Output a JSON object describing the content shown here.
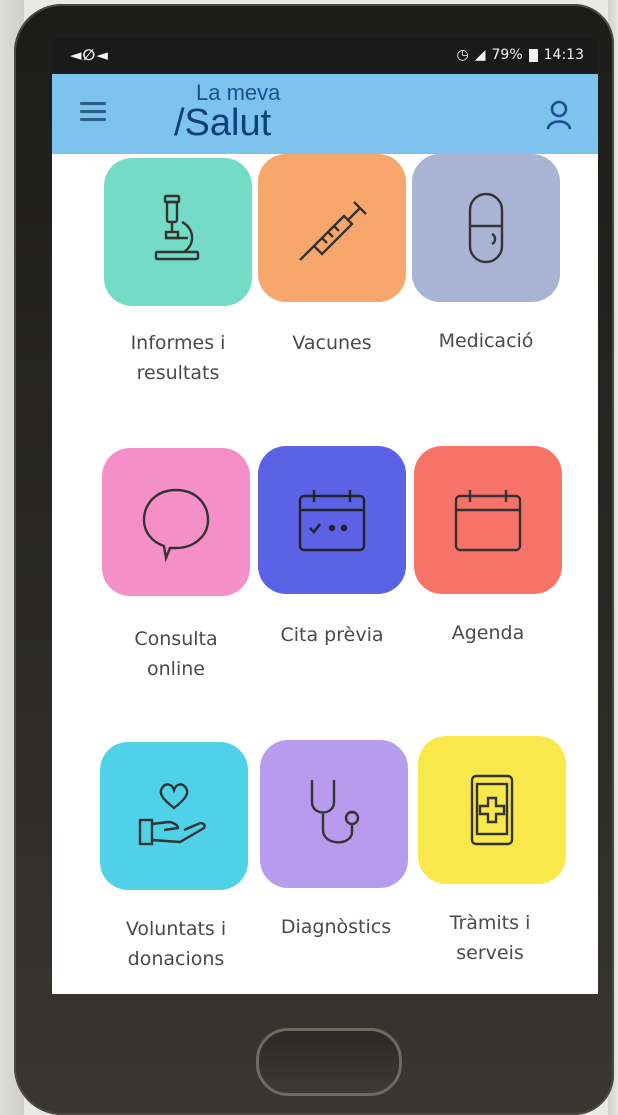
{
  "status_bar": {
    "left_icons": "◄∅◄",
    "battery": "79%",
    "time": "14:13"
  },
  "header": {
    "logo_line1": "La meva",
    "logo_line2": "/Salut",
    "menu_icon": "hamburger-icon",
    "profile_icon": "user-icon"
  },
  "tiles": [
    {
      "id": "informes",
      "label_lines": [
        "Informes i",
        "resultats"
      ],
      "color": "#74dbc6",
      "icon": "microscope-icon"
    },
    {
      "id": "vacunes",
      "label_lines": [
        "Vacunes"
      ],
      "color": "#f7a66c",
      "icon": "syringe-icon"
    },
    {
      "id": "medicacio",
      "label_lines": [
        "Medicació"
      ],
      "color": "#a9b4d4",
      "icon": "pill-icon"
    },
    {
      "id": "consulta",
      "label_lines": [
        "Consulta",
        "online"
      ],
      "color": "#f48fc8",
      "icon": "chat-bubble-icon"
    },
    {
      "id": "cita",
      "label_lines": [
        "Cita prèvia"
      ],
      "color": "#5c62e6",
      "icon": "calendar-check-icon"
    },
    {
      "id": "agenda",
      "label_lines": [
        "Agenda"
      ],
      "color": "#f7736a",
      "icon": "calendar-icon"
    },
    {
      "id": "voluntats",
      "label_lines": [
        "Voluntats i",
        "donacions"
      ],
      "color": "#4fd2e8",
      "icon": "heart-hand-icon"
    },
    {
      "id": "diagnostics",
      "label_lines": [
        "Diagnòstics"
      ],
      "color": "#b79ced",
      "icon": "stethoscope-icon"
    },
    {
      "id": "tramits",
      "label_lines": [
        "Tràmits i",
        "serveis"
      ],
      "color": "#f8e84a",
      "icon": "medical-tablet-icon"
    }
  ]
}
